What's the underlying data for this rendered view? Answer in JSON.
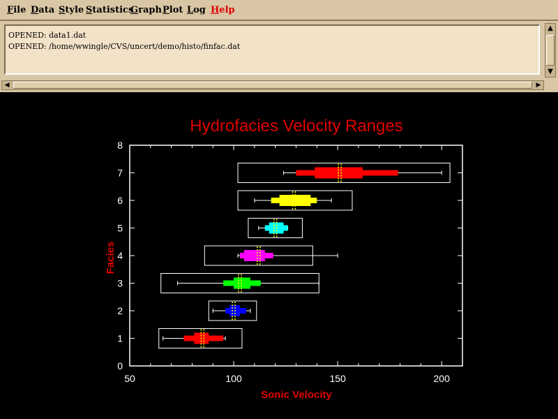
{
  "menu": [
    {
      "name": "menu-file",
      "first": "F",
      "rest": "ile",
      "color": "#000000"
    },
    {
      "name": "menu-data",
      "first": "D",
      "rest": "ata",
      "color": "#000000"
    },
    {
      "name": "menu-style",
      "first": "S",
      "rest": "tyle",
      "color": "#000000"
    },
    {
      "name": "menu-statistics",
      "first": "S",
      "rest": "tatistics",
      "color": "#000000"
    },
    {
      "name": "menu-graph",
      "first": "G",
      "rest": "raph",
      "color": "#000000"
    },
    {
      "name": "menu-plot",
      "first": "P",
      "rest": "lot",
      "color": "#000000"
    },
    {
      "name": "menu-log",
      "first": "L",
      "rest": "og",
      "color": "#000000"
    },
    {
      "name": "menu-help",
      "first": "H",
      "rest": "elp",
      "color": "#e00000"
    }
  ],
  "log": {
    "lines": [
      "OPENED: data1.dat",
      "OPENED: /home/wwingle/CVS/uncert/demo/histo/finfac.dat"
    ]
  },
  "icons": {
    "scroll_up": "scroll-up-arrow-icon",
    "scroll_down": "scroll-down-arrow-icon",
    "scroll_left": "scroll-left-arrow-icon",
    "scroll_right": "scroll-right-arrow-icon"
  },
  "colors": {
    "panel": "#d9c6a4",
    "title": "#e00000",
    "axis": "#ffffff",
    "median": "#ffff00"
  },
  "chart_data": {
    "type": "box",
    "orientation": "horizontal",
    "title": "Hydrofacies Velocity Ranges",
    "xlabel": "Sonic Velocity",
    "ylabel": "Facies",
    "xlim": [
      50,
      210
    ],
    "ylim": [
      0,
      8
    ],
    "xticks": [
      50,
      100,
      150,
      200
    ],
    "yticks": [
      0,
      1,
      2,
      3,
      4,
      5,
      6,
      7,
      8
    ],
    "series": [
      {
        "facies": 1,
        "color": "#ff0000",
        "whisker_min": 66,
        "p10": 76,
        "q1": 81,
        "median": 85,
        "q3": 88,
        "p90": 95,
        "whisker_max": 96,
        "range": [
          64,
          104
        ]
      },
      {
        "facies": 2,
        "color": "#0000ff",
        "whisker_min": 90,
        "p10": 96,
        "q1": 98,
        "median": 100,
        "q3": 103,
        "p90": 106,
        "whisker_max": 108,
        "range": [
          88,
          111
        ]
      },
      {
        "facies": 3,
        "color": "#00ff00",
        "whisker_min": 73,
        "p10": 95,
        "q1": 100,
        "median": 103,
        "q3": 108,
        "p90": 113,
        "whisker_max": 141,
        "range": [
          65,
          141
        ]
      },
      {
        "facies": 4,
        "color": "#ff00ff",
        "whisker_min": 102,
        "p10": 103,
        "q1": 105,
        "median": 112,
        "q3": 115,
        "p90": 119,
        "whisker_max": 150,
        "range": [
          86,
          138
        ]
      },
      {
        "facies": 5,
        "color": "#00ffff",
        "whisker_min": 112,
        "p10": 115,
        "q1": 117,
        "median": 120,
        "q3": 124,
        "p90": 126,
        "whisker_max": 126,
        "range": [
          107,
          133
        ]
      },
      {
        "facies": 6,
        "color": "#ffff00",
        "whisker_min": 110,
        "p10": 118,
        "q1": 122,
        "median": 129,
        "q3": 137,
        "p90": 140,
        "whisker_max": 147,
        "range": [
          102,
          157
        ]
      },
      {
        "facies": 7,
        "color": "#ff0000",
        "whisker_min": 124,
        "p10": 130,
        "q1": 139,
        "median": 151,
        "q3": 162,
        "p90": 179,
        "whisker_max": 200,
        "range": [
          102,
          204
        ]
      }
    ]
  }
}
